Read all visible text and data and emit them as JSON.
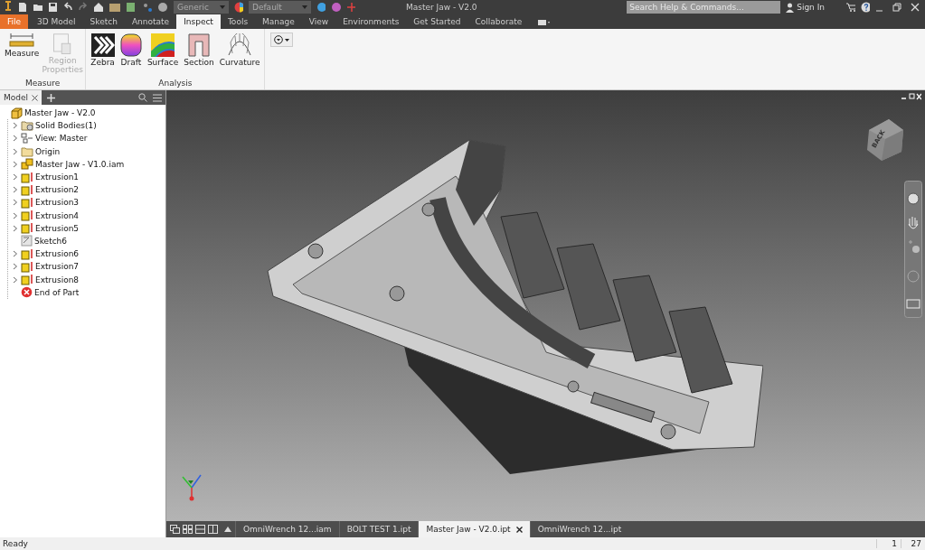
{
  "title_bar": {
    "generic_dropdown": "Generic",
    "default_dropdown": "Default",
    "title": "Master Jaw - V2.0",
    "search": {
      "placeholder": "Search Help & Commands..."
    },
    "sign_in": "Sign In"
  },
  "ribbon_tabs": [
    {
      "label": "File",
      "kind": "file",
      "selected": false
    },
    {
      "label": "3D Model",
      "kind": "tab",
      "selected": false
    },
    {
      "label": "Sketch",
      "kind": "tab",
      "selected": false
    },
    {
      "label": "Annotate",
      "kind": "tab",
      "selected": false
    },
    {
      "label": "Inspect",
      "kind": "tab",
      "selected": true
    },
    {
      "label": "Tools",
      "kind": "tab",
      "selected": false
    },
    {
      "label": "Manage",
      "kind": "tab",
      "selected": false
    },
    {
      "label": "View",
      "kind": "tab",
      "selected": false
    },
    {
      "label": "Environments",
      "kind": "tab",
      "selected": false
    },
    {
      "label": "Get Started",
      "kind": "tab",
      "selected": false
    },
    {
      "label": "Collaborate",
      "kind": "tab",
      "selected": false
    }
  ],
  "ribbon_panels": [
    {
      "title": "Measure",
      "tools": [
        {
          "label": "Measure",
          "kind": "measure",
          "disabled": false
        },
        {
          "label": "Region Properties",
          "kind": "region",
          "disabled": true
        }
      ]
    },
    {
      "title": "Analysis",
      "tools": [
        {
          "label": "Zebra",
          "kind": "zebra",
          "disabled": false
        },
        {
          "label": "Draft",
          "kind": "draft",
          "disabled": false
        },
        {
          "label": "Surface",
          "kind": "surface",
          "disabled": false
        },
        {
          "label": "Section",
          "kind": "section",
          "disabled": false
        },
        {
          "label": "Curvature",
          "kind": "curvature",
          "disabled": false
        }
      ]
    }
  ],
  "browser": {
    "tab": "Model",
    "tree": [
      {
        "label": "Master Jaw - V2.0",
        "kind": "part",
        "expandable": false,
        "children": [
          {
            "label": "Solid Bodies(1)",
            "kind": "bodies",
            "expandable": true
          },
          {
            "label": "View: Master",
            "kind": "view",
            "expandable": true
          },
          {
            "label": "Origin",
            "kind": "folder",
            "expandable": true
          },
          {
            "label": "Master Jaw - V1.0.iam",
            "kind": "assembly",
            "expandable": true
          },
          {
            "label": "Extrusion1",
            "kind": "extrusion",
            "expandable": true
          },
          {
            "label": "Extrusion2",
            "kind": "extrusion",
            "expandable": true
          },
          {
            "label": "Extrusion3",
            "kind": "extrusion",
            "expandable": true
          },
          {
            "label": "Extrusion4",
            "kind": "extrusion",
            "expandable": true
          },
          {
            "label": "Extrusion5",
            "kind": "extrusion",
            "expandable": true
          },
          {
            "label": "Sketch6",
            "kind": "sketch",
            "expandable": false
          },
          {
            "label": "Extrusion6",
            "kind": "extrusion",
            "expandable": true
          },
          {
            "label": "Extrusion7",
            "kind": "extrusion",
            "expandable": true
          },
          {
            "label": "Extrusion8",
            "kind": "extrusion",
            "expandable": true
          },
          {
            "label": "End of Part",
            "kind": "end",
            "expandable": false
          }
        ]
      }
    ]
  },
  "viewport": {
    "view_cube": "BACK"
  },
  "document_tabs": [
    {
      "label": "OmniWrench 12...iam",
      "selected": false
    },
    {
      "label": "BOLT TEST 1.ipt",
      "selected": false
    },
    {
      "label": "Master Jaw - V2.0.ipt",
      "selected": true
    },
    {
      "label": "OmniWrench 12...ipt",
      "selected": false
    }
  ],
  "status_bar": {
    "message": "Ready",
    "field_1": "1",
    "field_2": "27"
  }
}
